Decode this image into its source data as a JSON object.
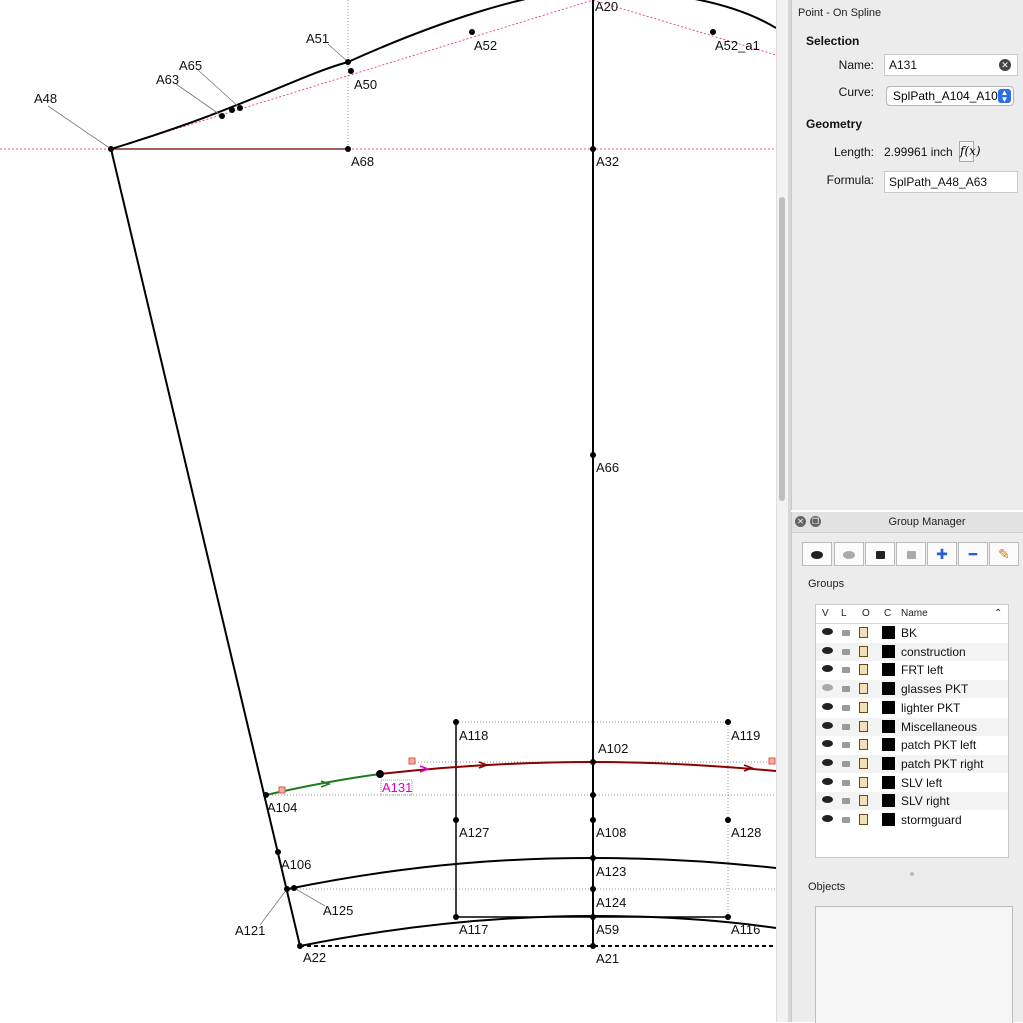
{
  "canvas": {
    "points": [
      {
        "id": "A20",
        "label": "A20"
      },
      {
        "id": "A51",
        "label": "A51"
      },
      {
        "id": "A52",
        "label": "A52"
      },
      {
        "id": "A52_a1",
        "label": "A52_a1"
      },
      {
        "id": "A65",
        "label": "A65"
      },
      {
        "id": "A63",
        "label": "A63"
      },
      {
        "id": "A48",
        "label": "A48"
      },
      {
        "id": "A50",
        "label": "A50"
      },
      {
        "id": "A68",
        "label": "A68"
      },
      {
        "id": "A32",
        "label": "A32"
      },
      {
        "id": "A66",
        "label": "A66"
      },
      {
        "id": "A118",
        "label": "A118"
      },
      {
        "id": "A119",
        "label": "A119"
      },
      {
        "id": "A102",
        "label": "A102"
      },
      {
        "id": "A131",
        "label": "A131"
      },
      {
        "id": "A104",
        "label": "A104"
      },
      {
        "id": "A127",
        "label": "A127"
      },
      {
        "id": "A108",
        "label": "A108"
      },
      {
        "id": "A128",
        "label": "A128"
      },
      {
        "id": "A106",
        "label": "A106"
      },
      {
        "id": "A123",
        "label": "A123"
      },
      {
        "id": "A125",
        "label": "A125"
      },
      {
        "id": "A124",
        "label": "A124"
      },
      {
        "id": "A121",
        "label": "A121"
      },
      {
        "id": "A117",
        "label": "A117"
      },
      {
        "id": "A59",
        "label": "A59"
      },
      {
        "id": "A116",
        "label": "A116"
      },
      {
        "id": "A22",
        "label": "A22"
      },
      {
        "id": "A21",
        "label": "A21"
      }
    ],
    "colors": {
      "line": "#000000",
      "guide": "#e8208a",
      "selected_curve": "#8b0000",
      "active_segment": "#1f7a1f",
      "selected_label": "#e000c8",
      "control_point": "#e05050"
    }
  },
  "properties": {
    "title": "Point - On Spline",
    "selection_heading": "Selection",
    "name_label": "Name:",
    "name_value": "A131",
    "curve_label": "Curve:",
    "curve_value": "SplPath_A104_A10",
    "geometry_heading": "Geometry",
    "length_label": "Length:",
    "length_value": "2.99961 inch",
    "fx_label": "f(x)",
    "formula_label": "Formula:",
    "formula_value": "SplPath_A48_A63"
  },
  "group_manager": {
    "title": "Group Manager",
    "toolbar": [
      "show-all",
      "hide-all",
      "lock-all",
      "unlock-all",
      "add-group",
      "remove-group",
      "edit-group"
    ],
    "groups_label": "Groups",
    "columns": {
      "v": "V",
      "l": "L",
      "o": "O",
      "c": "C",
      "name": "Name"
    },
    "groups": [
      {
        "name": "BK",
        "visible": true
      },
      {
        "name": "construction",
        "visible": true
      },
      {
        "name": "FRT left",
        "visible": true
      },
      {
        "name": "glasses PKT",
        "visible": false
      },
      {
        "name": "lighter PKT",
        "visible": true
      },
      {
        "name": "Miscellaneous",
        "visible": true
      },
      {
        "name": "patch PKT left",
        "visible": true
      },
      {
        "name": "patch PKT right",
        "visible": true
      },
      {
        "name": "SLV left",
        "visible": true
      },
      {
        "name": "SLV right",
        "visible": true
      },
      {
        "name": "stormguard",
        "visible": true
      }
    ],
    "objects_label": "Objects"
  }
}
